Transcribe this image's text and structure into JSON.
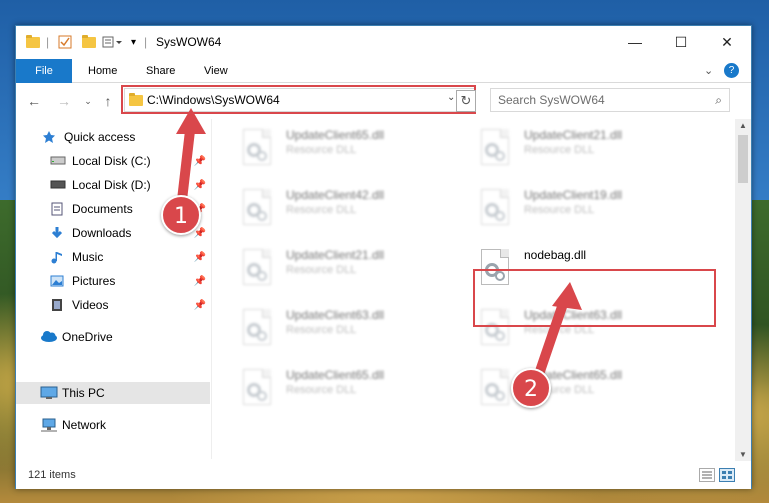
{
  "window": {
    "title": "SysWOW64",
    "controls": {
      "minimize": "—",
      "maximize": "☐",
      "close": "✕"
    }
  },
  "ribbon": {
    "tabs": [
      "File",
      "Home",
      "Share",
      "View"
    ],
    "expand_icon": "chevron-down-icon",
    "help_icon": "help-icon",
    "help": "?"
  },
  "address": {
    "path": "C:\\Windows\\SysWOW64",
    "refresh_icon": "refresh-icon"
  },
  "search": {
    "placeholder": "Search SysWOW64"
  },
  "sidebar": {
    "items": [
      {
        "label": "Quick access",
        "icon": "star-icon",
        "pinned": false
      },
      {
        "label": "Local Disk (C:)",
        "icon": "drive-icon",
        "pinned": true
      },
      {
        "label": "Local Disk (D:)",
        "icon": "drive-icon",
        "pinned": true
      },
      {
        "label": "Documents",
        "icon": "documents-icon",
        "pinned": true
      },
      {
        "label": "Downloads",
        "icon": "downloads-icon",
        "pinned": true
      },
      {
        "label": "Music",
        "icon": "music-icon",
        "pinned": true
      },
      {
        "label": "Pictures",
        "icon": "pictures-icon",
        "pinned": true
      },
      {
        "label": "Videos",
        "icon": "videos-icon",
        "pinned": true
      },
      {
        "label": "OneDrive",
        "icon": "cloud-icon",
        "pinned": false
      },
      {
        "label": "This PC",
        "icon": "computer-icon",
        "pinned": false,
        "selected": true
      },
      {
        "label": "Network",
        "icon": "network-icon",
        "pinned": false
      }
    ]
  },
  "files": [
    {
      "name": "UpdateClient65.dll",
      "type": "Resource DLL"
    },
    {
      "name": "UpdateClient21.dll",
      "type": "Resource DLL"
    },
    {
      "name": "UpdateClient42.dll",
      "type": "Resource DLL"
    },
    {
      "name": "UpdateClient19.dll",
      "type": "Resource DLL"
    },
    {
      "name": "UpdateClient21.dll",
      "type": "Resource DLL"
    },
    {
      "name": "nodebag.dll",
      "type": ""
    },
    {
      "name": "UpdateClient63.dll",
      "type": "Resource DLL"
    },
    {
      "name": "UpdateClient63.dll",
      "type": "Resource DLL"
    },
    {
      "name": "UpdateClient65.dll",
      "type": "Resource DLL"
    },
    {
      "name": "UpdateClient65.dll",
      "type": "Resource DLL"
    }
  ],
  "status": {
    "item_count": "121 items"
  },
  "annotations": {
    "step1": "1",
    "step2": "2"
  },
  "colors": {
    "accent": "#1979ca",
    "highlight": "#d9474b"
  }
}
